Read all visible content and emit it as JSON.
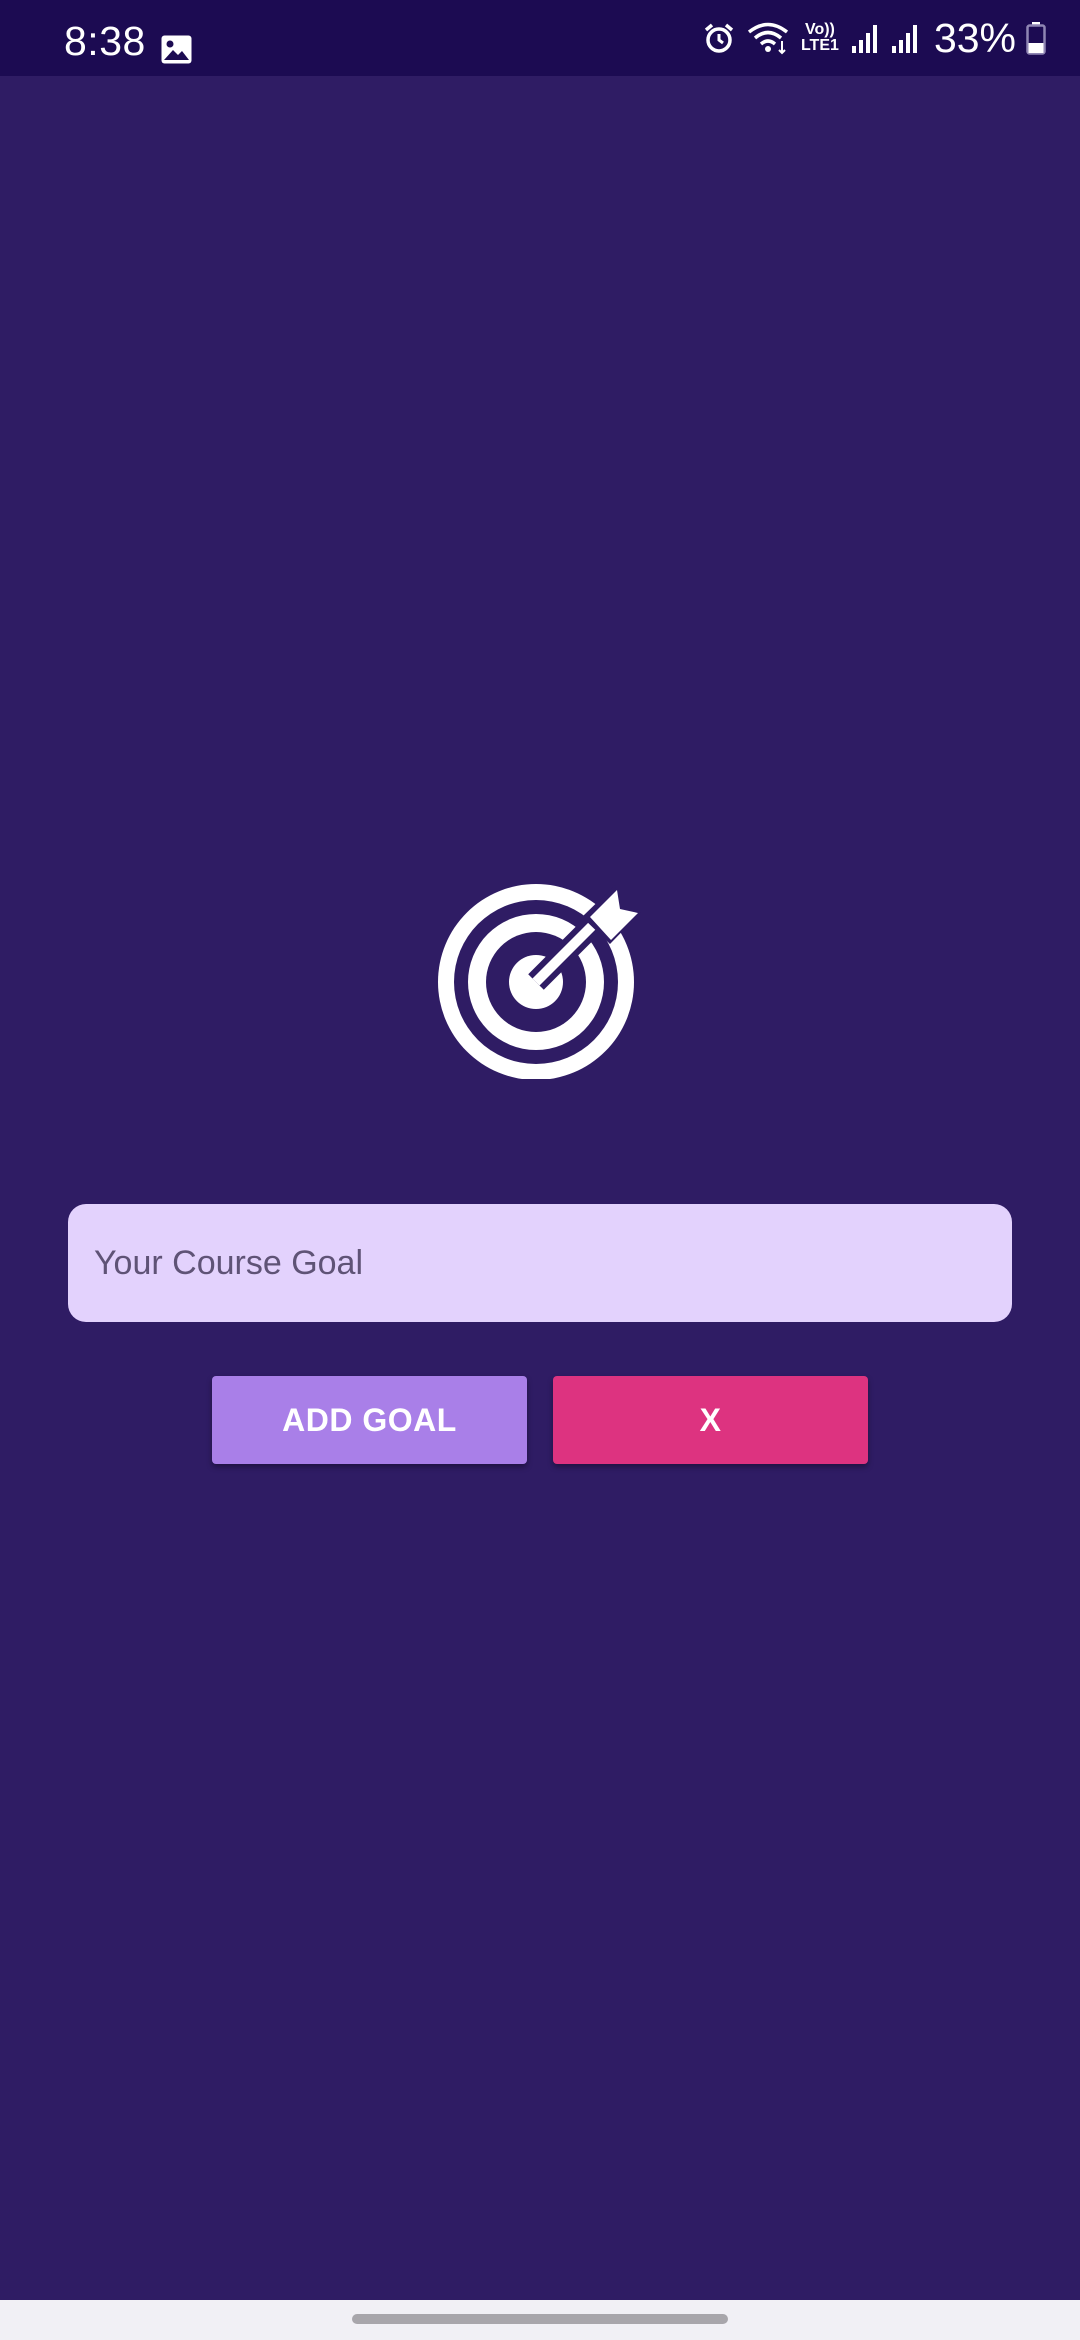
{
  "status_bar": {
    "time": "8:38",
    "volte_line1": "Vo))",
    "volte_line2": "LTE1",
    "battery": "33%",
    "icons": [
      "gallery-icon",
      "alarm-icon",
      "wifi-icon",
      "signal-icon",
      "signal-icon",
      "battery-icon"
    ]
  },
  "main": {
    "icon": "target-arrow-icon",
    "goal_input": {
      "placeholder": "Your Course Goal",
      "value": ""
    },
    "add_button_label": "ADD GOAL",
    "cancel_button_label": "X"
  },
  "colors": {
    "background": "#2f1c64",
    "status_bar": "#1c0b52",
    "input_background": "#e3d2fd",
    "add_button": "#a97fe8",
    "cancel_button": "#dd3380"
  }
}
